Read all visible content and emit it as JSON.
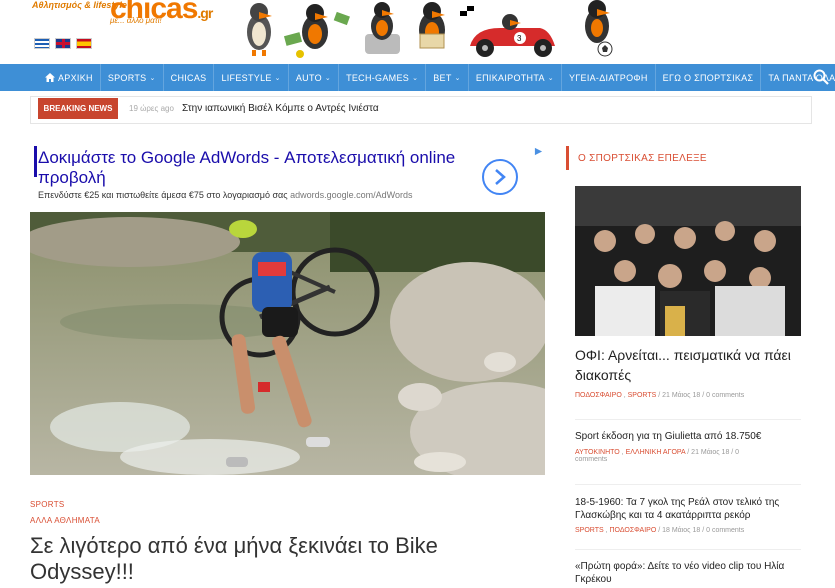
{
  "logo": {
    "tagline": "Αθλητισμός & lifestyle",
    "name": "chicas",
    "tld": ".gr",
    "slogan": "με... άλλο ματι!"
  },
  "languages": [
    {
      "name": "greek-flag"
    },
    {
      "name": "uk-flag"
    },
    {
      "name": "spanish-flag"
    }
  ],
  "nav": {
    "items": [
      {
        "label": "ΑΡΧΙΚΗ",
        "icon": "home-icon",
        "dropdown": false
      },
      {
        "label": "SPORTS",
        "dropdown": true
      },
      {
        "label": "CHICAS",
        "dropdown": false
      },
      {
        "label": "LIFESTYLE",
        "dropdown": true
      },
      {
        "label": "AUTO",
        "dropdown": true
      },
      {
        "label": "TECH-GAMES",
        "dropdown": true
      },
      {
        "label": "BET",
        "dropdown": true
      },
      {
        "label": "ΕΠΙΚΑΙΡΟΤΗΤΑ",
        "dropdown": true
      },
      {
        "label": "ΥΓΕΙΑ-ΔΙΑΤΡΟΦΗ",
        "dropdown": false
      },
      {
        "label": "ΕΓΩ Ο ΣΠΟΡΤΣΙΚΑΣ",
        "dropdown": false
      },
      {
        "label": "ΤΑ ΠΑΝΤΑ ΟΛΑ",
        "dropdown": false
      }
    ]
  },
  "breaking": {
    "label": "BREAKING NEWS",
    "time": "19 ώρες ago",
    "text": "Στην ιαπωνική Βισέλ Κόμπε ο Αντρές Ινιέστα"
  },
  "ad": {
    "title": "Δοκιμάστε το Google AdWords - Αποτελεσματική online προβολή",
    "text": "Επενδύστε €25 και πιστωθείτε άμεσα €75 στο λογαριασμό σας",
    "url": "adwords.google.com/AdWords"
  },
  "article": {
    "category1": "SPORTS",
    "category2": "ΑΛΛΑ ΑΘΛΗΜΑΤΑ",
    "title": "Σε λιγότερο από ένα μήνα ξεκινάει το Bike Odyssey!!!"
  },
  "sidebar": {
    "heading": "Ο ΣΠΟΡΤΣΙΚΑΣ ΕΠΕΛΕΞΕ",
    "main": {
      "title": "ΟΦΙ: Αρνείται... πεισματικά να πάει διακοπές",
      "cat1": "ΠΟΔΟΣΦΑΙΡΟ",
      "cat2": "SPORTS",
      "date": "/ 21 Μάιος 18 / 0 comments"
    },
    "items": [
      {
        "title": "Sport έκδοση για τη Giulietta από 18.750€",
        "cat1": "ΑΥΤΟΚΙΝΗΤΟ",
        "cat2": "ΕΛΛΗΝΙΚΗ ΑΓΟΡΑ",
        "date": "/ 21 Μάιος 18 / 0",
        "date2": "comments"
      },
      {
        "title": "18-5-1960: Τα 7 γκολ της Ρεάλ στον τελικό της Γλασκώβης και τα 4 ακατάρριπτα ρεκόρ",
        "cat1": "SPORTS",
        "cat2": "ΠΟΔΟΣΦΑΙΡΟ",
        "date": "/ 18 Μάιος 18 / 0 comments"
      },
      {
        "title": "«Πρώτη φορά»: Δείτε το νέο video clip του Ηλία Γκρέκου"
      }
    ]
  },
  "colors": {
    "nav": "#3e8fd6",
    "accent": "#d94e33",
    "logo": "#f07800"
  }
}
